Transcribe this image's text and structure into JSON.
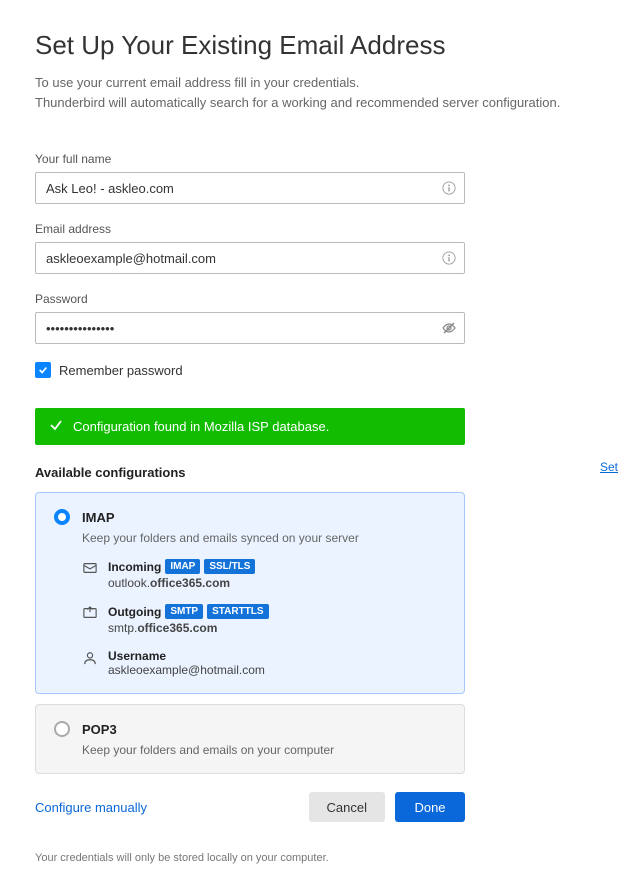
{
  "heading": "Set Up Your Existing Email Address",
  "subtitle_line1": "To use your current email address fill in your credentials.",
  "subtitle_line2": "Thunderbird will automatically search for a working and recommended server configuration.",
  "fields": {
    "fullname": {
      "label": "Your full name",
      "value": "Ask Leo! - askleo.com"
    },
    "email": {
      "label": "Email address",
      "value": "askleoexample@hotmail.com"
    },
    "password": {
      "label": "Password",
      "value": "•••••••••••••••"
    }
  },
  "remember": {
    "label": "Remember password",
    "checked": true
  },
  "status": "Configuration found in Mozilla ISP database.",
  "available_configs_header": "Available configurations",
  "configs": {
    "imap": {
      "title": "IMAP",
      "desc": "Keep your folders and emails synced on your server",
      "incoming": {
        "label": "Incoming",
        "badge1": "IMAP",
        "badge2": "SSL/TLS",
        "host_prefix": "outlook.",
        "host_bold": "office365.com"
      },
      "outgoing": {
        "label": "Outgoing",
        "badge1": "SMTP",
        "badge2": "STARTTLS",
        "host_prefix": "smtp.",
        "host_bold": "office365.com"
      },
      "username": {
        "label": "Username",
        "value": "askleoexample@hotmail.com"
      }
    },
    "pop3": {
      "title": "POP3",
      "desc": "Keep your folders and emails on your computer"
    }
  },
  "actions": {
    "configure": "Configure manually",
    "cancel": "Cancel",
    "done": "Done"
  },
  "footer": "Your credentials will only be stored locally on your computer.",
  "side_link": "Set"
}
